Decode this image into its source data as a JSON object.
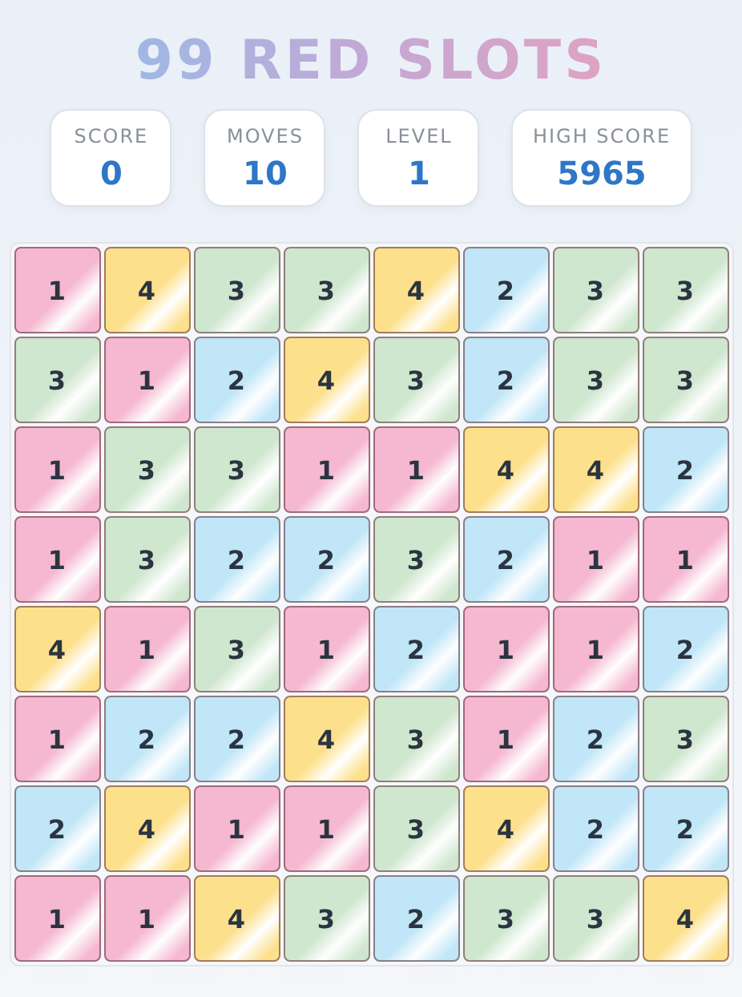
{
  "title": "99 RED SLOTS",
  "stats": [
    {
      "label": "SCORE",
      "value": "0"
    },
    {
      "label": "MOVES",
      "value": "10"
    },
    {
      "label": "LEVEL",
      "value": "1"
    },
    {
      "label": "HIGH SCORE",
      "value": "5965"
    }
  ],
  "grid": [
    [
      {
        "value": "1",
        "color": "#f5b8d0"
      },
      {
        "value": "4",
        "color": "#fde08c"
      },
      {
        "value": "3",
        "color": "#cfe6cf"
      },
      {
        "value": "3",
        "color": "#cfe6cf"
      },
      {
        "value": "4",
        "color": "#fde08c"
      },
      {
        "value": "2",
        "color": "#c0e6f8"
      },
      {
        "value": "3",
        "color": "#cfe6cf"
      },
      {
        "value": "3",
        "color": "#cfe6cf"
      }
    ],
    [
      {
        "value": "3",
        "color": "#cfe6cf"
      },
      {
        "value": "1",
        "color": "#f5b8d0"
      },
      {
        "value": "2",
        "color": "#c0e6f8"
      },
      {
        "value": "4",
        "color": "#fde08c"
      },
      {
        "value": "3",
        "color": "#cfe6cf"
      },
      {
        "value": "2",
        "color": "#c0e6f8"
      },
      {
        "value": "3",
        "color": "#cfe6cf"
      },
      {
        "value": "3",
        "color": "#cfe6cf"
      }
    ],
    [
      {
        "value": "1",
        "color": "#f5b8d0"
      },
      {
        "value": "3",
        "color": "#cfe6cf"
      },
      {
        "value": "3",
        "color": "#cfe6cf"
      },
      {
        "value": "1",
        "color": "#f5b8d0"
      },
      {
        "value": "1",
        "color": "#f5b8d0"
      },
      {
        "value": "4",
        "color": "#fde08c"
      },
      {
        "value": "4",
        "color": "#fde08c"
      },
      {
        "value": "2",
        "color": "#c0e6f8"
      }
    ],
    [
      {
        "value": "1",
        "color": "#f5b8d0"
      },
      {
        "value": "3",
        "color": "#cfe6cf"
      },
      {
        "value": "2",
        "color": "#c0e6f8"
      },
      {
        "value": "2",
        "color": "#c0e6f8"
      },
      {
        "value": "3",
        "color": "#cfe6cf"
      },
      {
        "value": "2",
        "color": "#c0e6f8"
      },
      {
        "value": "1",
        "color": "#f5b8d0"
      },
      {
        "value": "1",
        "color": "#f5b8d0"
      }
    ],
    [
      {
        "value": "4",
        "color": "#fde08c"
      },
      {
        "value": "1",
        "color": "#f5b8d0"
      },
      {
        "value": "3",
        "color": "#cfe6cf"
      },
      {
        "value": "1",
        "color": "#f5b8d0"
      },
      {
        "value": "2",
        "color": "#c0e6f8"
      },
      {
        "value": "1",
        "color": "#f5b8d0"
      },
      {
        "value": "1",
        "color": "#f5b8d0"
      },
      {
        "value": "2",
        "color": "#c0e6f8"
      }
    ],
    [
      {
        "value": "1",
        "color": "#f5b8d0"
      },
      {
        "value": "2",
        "color": "#c0e6f8"
      },
      {
        "value": "2",
        "color": "#c0e6f8"
      },
      {
        "value": "4",
        "color": "#fde08c"
      },
      {
        "value": "3",
        "color": "#cfe6cf"
      },
      {
        "value": "1",
        "color": "#f5b8d0"
      },
      {
        "value": "2",
        "color": "#c0e6f8"
      },
      {
        "value": "3",
        "color": "#cfe6cf"
      }
    ],
    [
      {
        "value": "2",
        "color": "#c0e6f8"
      },
      {
        "value": "4",
        "color": "#fde08c"
      },
      {
        "value": "1",
        "color": "#f5b8d0"
      },
      {
        "value": "1",
        "color": "#f5b8d0"
      },
      {
        "value": "3",
        "color": "#cfe6cf"
      },
      {
        "value": "4",
        "color": "#fde08c"
      },
      {
        "value": "2",
        "color": "#c0e6f8"
      },
      {
        "value": "2",
        "color": "#c0e6f8"
      }
    ],
    [
      {
        "value": "1",
        "color": "#f5b8d0"
      },
      {
        "value": "1",
        "color": "#f5b8d0"
      },
      {
        "value": "4",
        "color": "#fde08c"
      },
      {
        "value": "3",
        "color": "#cfe6cf"
      },
      {
        "value": "2",
        "color": "#c0e6f8"
      },
      {
        "value": "3",
        "color": "#cfe6cf"
      },
      {
        "value": "3",
        "color": "#cfe6cf"
      },
      {
        "value": "4",
        "color": "#fde08c"
      }
    ]
  ]
}
